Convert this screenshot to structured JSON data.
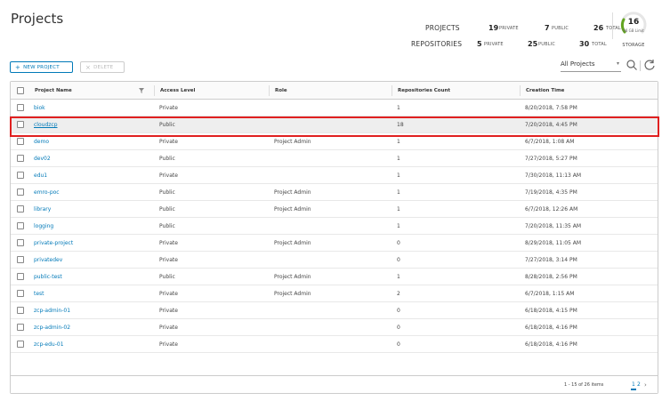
{
  "page": {
    "title": "Projects"
  },
  "stats": {
    "projects_label": "PROJECTS",
    "repositories_label": "REPOSITORIES",
    "projects": {
      "private": "19",
      "private_label": "PRIVATE",
      "public": "7",
      "public_label": "PUBLIC",
      "total": "26",
      "total_label": "TOTAL"
    },
    "repositories": {
      "private": "5",
      "private_label": "PRIVATE",
      "public": "25",
      "public_label": "PUBLIC",
      "total": "30",
      "total_label": "TOTAL"
    },
    "storage": {
      "value": "16",
      "limit": "98 GB Limit",
      "label": "STORAGE",
      "used_fraction": 0.16
    }
  },
  "toolbar": {
    "new_project": "NEW PROJECT",
    "delete": "DELETE",
    "filter_value": "All Projects"
  },
  "table": {
    "columns": [
      "Project Name",
      "Access Level",
      "Role",
      "Repositories Count",
      "Creation Time"
    ],
    "rows": [
      {
        "name": "biok",
        "access": "Private",
        "role": "",
        "repos": "1",
        "created": "8/20/2018, 7:58 PM"
      },
      {
        "name": "cloudzcp",
        "access": "Public",
        "role": "",
        "repos": "18",
        "created": "7/20/2018, 4:45 PM"
      },
      {
        "name": "demo",
        "access": "Private",
        "role": "Project Admin",
        "repos": "1",
        "created": "6/7/2018, 1:08 AM"
      },
      {
        "name": "dev02",
        "access": "Public",
        "role": "",
        "repos": "1",
        "created": "7/27/2018, 5:27 PM"
      },
      {
        "name": "edu1",
        "access": "Private",
        "role": "",
        "repos": "1",
        "created": "7/30/2018, 11:13 AM"
      },
      {
        "name": "emro-poc",
        "access": "Public",
        "role": "Project Admin",
        "repos": "1",
        "created": "7/19/2018, 4:35 PM"
      },
      {
        "name": "library",
        "access": "Public",
        "role": "Project Admin",
        "repos": "1",
        "created": "6/7/2018, 12:26 AM"
      },
      {
        "name": "logging",
        "access": "Public",
        "role": "",
        "repos": "1",
        "created": "7/20/2018, 11:35 AM"
      },
      {
        "name": "private-project",
        "access": "Private",
        "role": "Project Admin",
        "repos": "0",
        "created": "8/29/2018, 11:05 AM"
      },
      {
        "name": "privatedev",
        "access": "Private",
        "role": "",
        "repos": "0",
        "created": "7/27/2018, 3:14 PM"
      },
      {
        "name": "public-test",
        "access": "Public",
        "role": "Project Admin",
        "repos": "1",
        "created": "8/28/2018, 2:56 PM"
      },
      {
        "name": "test",
        "access": "Private",
        "role": "Project Admin",
        "repos": "2",
        "created": "6/7/2018, 1:15 AM"
      },
      {
        "name": "zcp-admin-01",
        "access": "Private",
        "role": "",
        "repos": "0",
        "created": "6/18/2018, 4:15 PM"
      },
      {
        "name": "zcp-admin-02",
        "access": "Private",
        "role": "",
        "repos": "0",
        "created": "6/18/2018, 4:16 PM"
      },
      {
        "name": "zcp-edu-01",
        "access": "Private",
        "role": "",
        "repos": "0",
        "created": "6/18/2018, 4:16 PM"
      }
    ],
    "footer": {
      "info": "1 - 15 of 26 items",
      "page1": "1",
      "page2": "2"
    }
  },
  "colors": {
    "accent": "#0079b8",
    "highlight": "#e02020",
    "gauge": "#62a420"
  }
}
